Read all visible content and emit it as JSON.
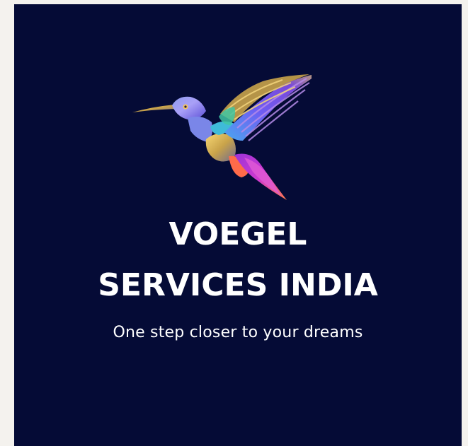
{
  "brand": {
    "line1": "VOEGEL",
    "line2": "SERVICES INDIA",
    "tagline": "One step closer to your dreams"
  },
  "logo": {
    "icon": "hummingbird-icon"
  },
  "colors": {
    "page_background": "#f4f2ee",
    "card_background": "#050b36",
    "text": "#ffffff"
  }
}
